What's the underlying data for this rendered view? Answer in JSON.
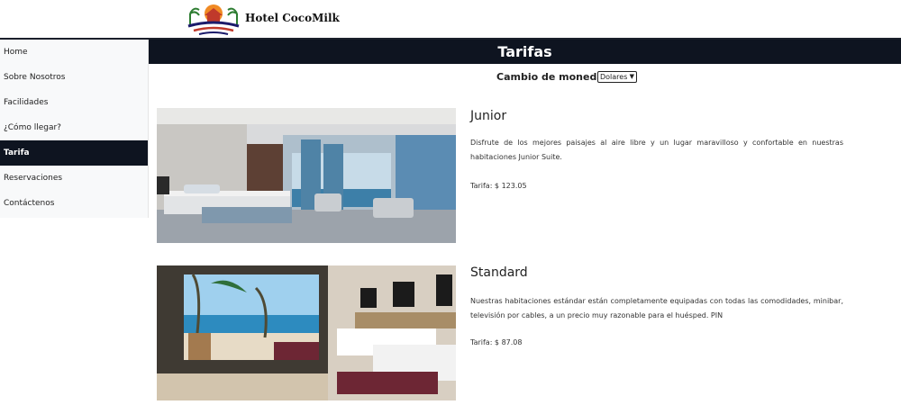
{
  "header": {
    "brand": "Hotel CocoMilk"
  },
  "sidebar": {
    "items": [
      {
        "label": "Home"
      },
      {
        "label": "Sobre Nosotros"
      },
      {
        "label": "Facilidades"
      },
      {
        "label": "¿Cómo llegar?"
      },
      {
        "label": "Tarifa",
        "active": true
      },
      {
        "label": "Reservaciones"
      },
      {
        "label": "Contáctenos"
      }
    ]
  },
  "main": {
    "title": "Tarifas",
    "currency": {
      "label": "Cambio de moneda:",
      "selected": "Dolares"
    },
    "rooms": [
      {
        "name": "Junior",
        "description": "Disfrute de los mejores paisajes al aire libre y un lugar maravilloso y confortable en nuestras habitaciones Junior Suite.",
        "price": "Tarifa: $ 123.05"
      },
      {
        "name": "Standard",
        "description": "Nuestras habitaciones estándar están completamente equipadas con todas las comodidades, minibar, televisión por cables, a un precio muy razonable para el huésped. PIN",
        "price": "Tarifa: $ 87.08"
      }
    ]
  },
  "colors": {
    "nav_dark": "#0e1420",
    "sidebar_bg": "#f8f9fa"
  }
}
